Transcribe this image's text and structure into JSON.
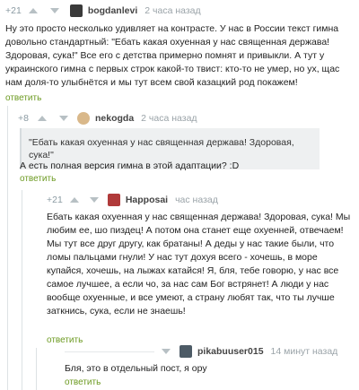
{
  "comments": [
    {
      "score": "+21",
      "nick": "bogdanlevi",
      "time": "2 часа назад",
      "text": "Ну это просто несколько удивляет на контрасте. У нас в России текст гимна довольно стандартный: \"Ебать какая охуенная у нас священная держава! Здоровая, сука!\" Все его с детства примерно помнят и привыкли. А тут у украинского гимна с первых строк какой-то твист: кто-то не умер, но ух, щас нам доля-то улыбнётся и мы тут всем свой казацкий род покажем!",
      "reply": "ответить"
    },
    {
      "score": "+8",
      "nick": "nekogda",
      "time": "2 часа назад",
      "quote": "\"Ебать какая охуенная у нас священная держава! Здоровая, сука!\"",
      "text": "А есть полная версия гимна в этой адаптации? :D",
      "reply": "ответить"
    },
    {
      "score": "+21",
      "nick": "Happosai",
      "time": "час назад",
      "text": "Ебать какая охуенная у нас священная держава! Здоровая, сука! Мы любим ее, шо пиздец! А потом она станет еще охуенней, отвечаем! Мы тут все друг другу, как братаны! А деды у нас такие были, что ломы пальцами гнули! У нас тут дохуя всего - хочешь, в море купайся, хочешь, на лыжах катайся! Я, бля, тебе говорю, у нас все самое лучшее, а если чо, за нас сам Бог встрянет! А люди у нас вообще охуенные, и все умеют, а страну любят так, что ты лучше заткнись, сука, если не знаешь!",
      "reply": "ответить"
    },
    {
      "score": "",
      "nick": "pikabuuser015",
      "time": "14 минут назад",
      "text": "Бля, это в отдельный пост, я ору",
      "reply": "ответить"
    }
  ],
  "icons": [
    "arrow-up-icon",
    "arrow-down-icon",
    "avatar-image"
  ],
  "colors": {
    "reply": "#6c9a21",
    "muted": "#9aa3a8",
    "quote_bg": "#eef0f1"
  }
}
